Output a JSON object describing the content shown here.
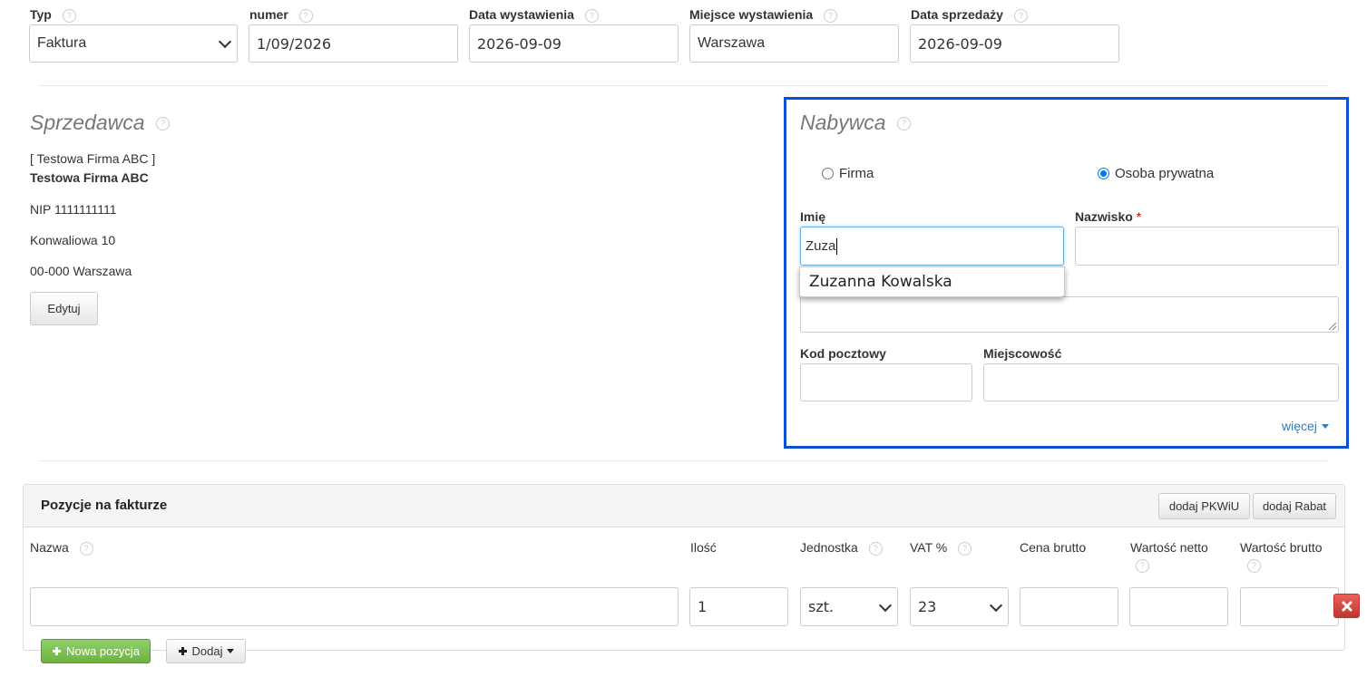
{
  "top_fields": {
    "typ": {
      "label": "Typ",
      "value": "Faktura"
    },
    "numer": {
      "label": "numer",
      "value": "1/09/2026"
    },
    "data_wystawienia": {
      "label": "Data wystawienia",
      "value": "2026-09-09"
    },
    "miejsce_wystawienia": {
      "label": "Miejsce wystawienia",
      "value": "Warszawa"
    },
    "data_sprzedazy": {
      "label": "Data sprzedaży",
      "value": "2026-09-09"
    }
  },
  "help_glyph": "?",
  "seller": {
    "title": "Sprzedawca",
    "short_name": "[ Testowa Firma ABC ]",
    "name": "Testowa Firma ABC",
    "nip": "NIP 1111111111",
    "street": "Konwaliowa 10",
    "city": "00-000 Warszawa",
    "edit_button": "Edytuj"
  },
  "buyer": {
    "title": "Nabywca",
    "radio_company": "Firma",
    "radio_private": "Osoba prywatna",
    "selected": "private",
    "first_name_label": "Imię",
    "first_name_value": "Zuza",
    "last_name_label": "Nazwisko",
    "required_mark": "*",
    "last_name_value": "",
    "autocomplete_suggestion": "Zuzanna Kowalska",
    "postal_code_label": "Kod pocztowy",
    "city_label": "Miejscowość",
    "more_link": "więcej",
    "highlight_color": "#0a4fd6"
  },
  "positions": {
    "title": "Pozycje na fakturze",
    "btn_pkwiu": "dodaj PKWiU",
    "btn_rabat": "dodaj Rabat",
    "columns": {
      "name": "Nazwa",
      "qty": "Ilość",
      "unit": "Jednostka",
      "vat": "VAT %",
      "gross_price": "Cena brutto",
      "net_value": "Wartość netto",
      "gross_value": "Wartość brutto"
    },
    "row": {
      "name": "",
      "qty": "1",
      "unit": "szt.",
      "vat": "23",
      "gross_price": "",
      "net_value": "",
      "gross_value": ""
    },
    "btn_new_position": "Nowa pozycja",
    "btn_add": "Dodaj"
  }
}
